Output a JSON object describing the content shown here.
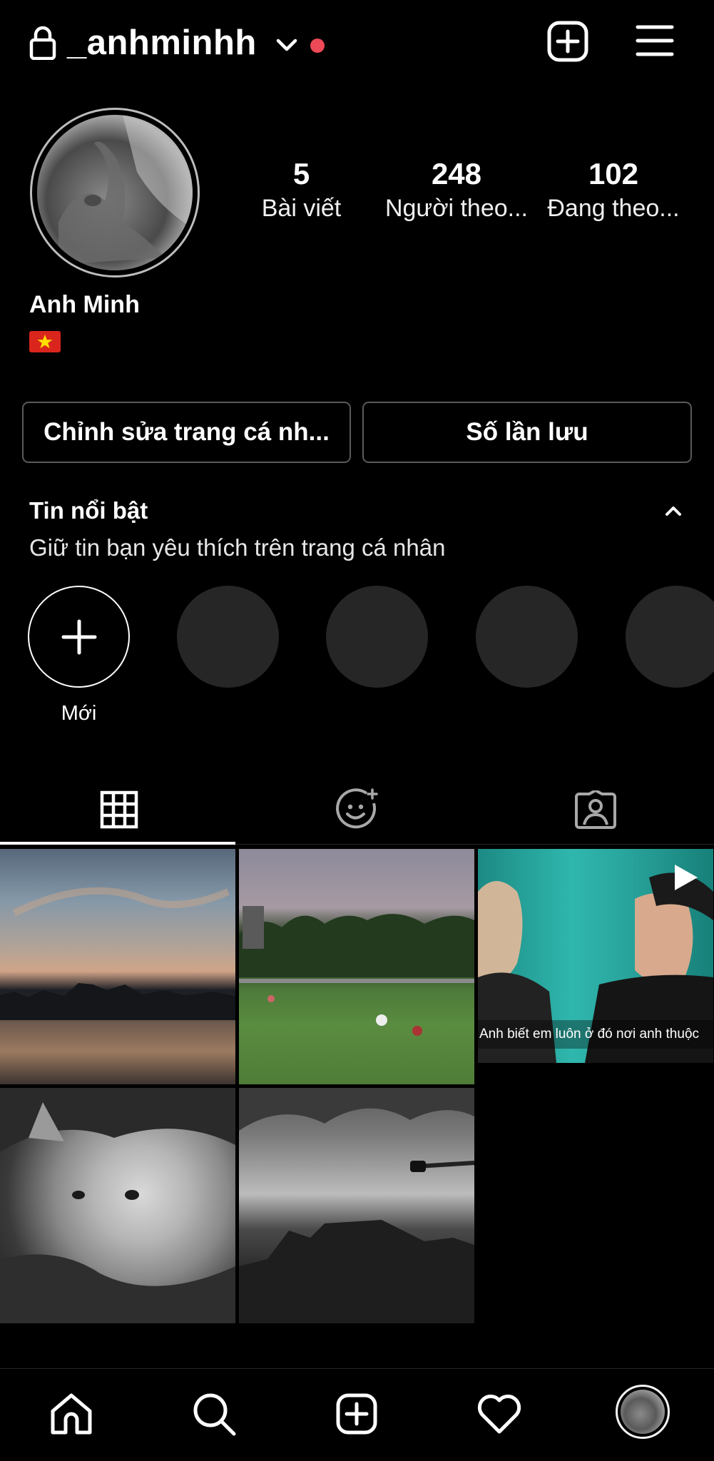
{
  "header": {
    "username": "_anhminhh",
    "notification_dot_color": "#ed4956",
    "icons": [
      "lock-icon",
      "chevron-down-icon",
      "add-post-icon",
      "menu-icon"
    ]
  },
  "profile": {
    "display_name": "Anh Minh",
    "flag": "Vietnam flag emoji",
    "stats": [
      {
        "value": "5",
        "label": "Bài viết"
      },
      {
        "value": "248",
        "label": "Người theo..."
      },
      {
        "value": "102",
        "label": "Đang theo..."
      }
    ]
  },
  "actions": {
    "edit_profile": "Chỉnh sửa trang cá nh...",
    "saved": "Số lần lưu"
  },
  "highlights": {
    "title": "Tin nổi bật",
    "subtitle": "Giữ tin bạn yêu thích trên trang cá nhân",
    "new_label": "Mới",
    "placeholder_count": 4
  },
  "tabs": [
    {
      "name": "posts-grid",
      "icon": "grid-icon",
      "active": true
    },
    {
      "name": "reels",
      "icon": "smiley-sparkle-icon",
      "active": false
    },
    {
      "name": "tagged",
      "icon": "tagged-person-icon",
      "active": false
    }
  ],
  "posts": [
    {
      "kind": "photo",
      "subject": "sunset over lake"
    },
    {
      "kind": "photo",
      "subject": "park at dusk"
    },
    {
      "kind": "video",
      "caption": "Anh biết em luôn ở đó nơi anh thuộc"
    },
    {
      "kind": "photo",
      "subject": "kitten"
    },
    {
      "kind": "photo",
      "subject": "cloudy sky street"
    }
  ],
  "bottom_nav": [
    "home-icon",
    "search-icon",
    "add-icon",
    "heart-icon",
    "profile-avatar"
  ],
  "colors": {
    "background": "#000000",
    "text": "#ffffff",
    "button_border": "#5a5a5a",
    "highlight_placeholder": "#262626"
  }
}
